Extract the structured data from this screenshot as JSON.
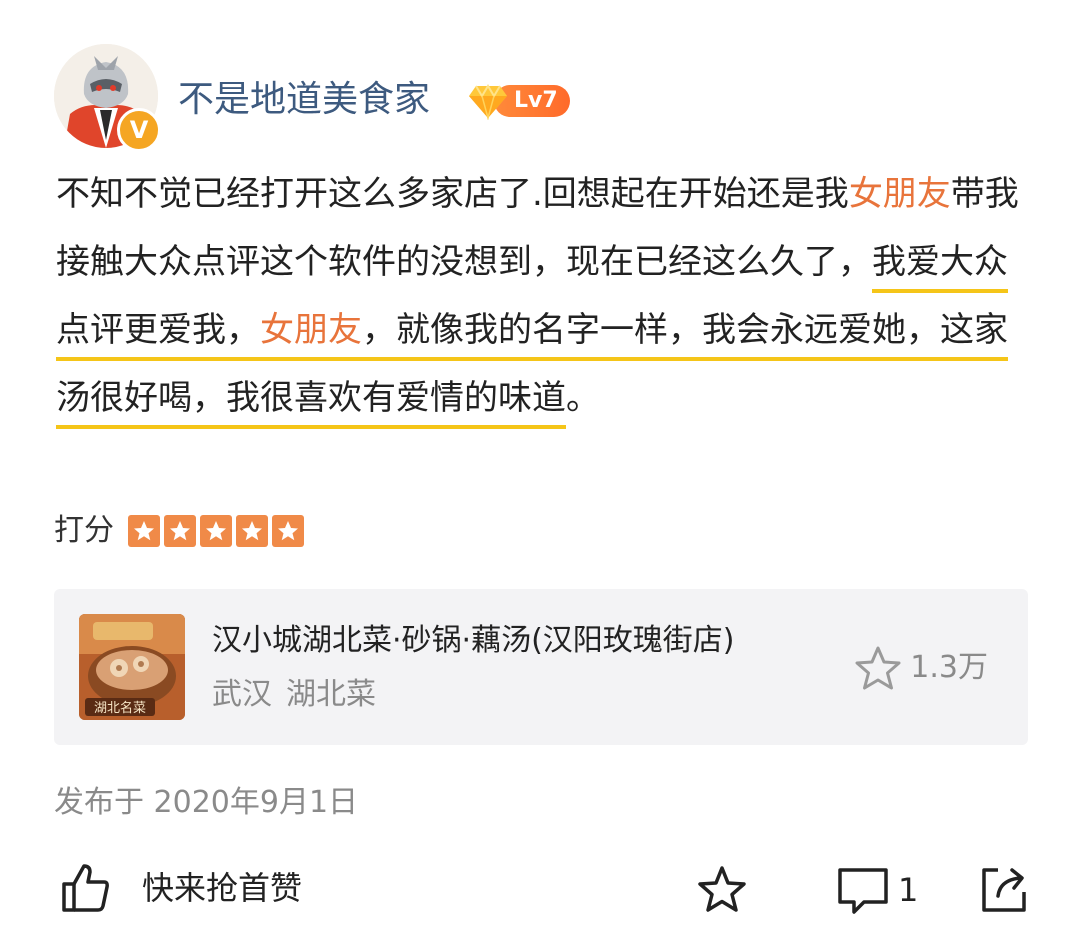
{
  "user": {
    "name": "不是地道美食家",
    "verified_badge": "V",
    "level": "Lv7",
    "avatar_icon": "masked-character-red-jacket-avatar"
  },
  "review": {
    "segments": [
      {
        "text": "不知不觉已经打开这么多家店了.回想起在开始还是我",
        "style": "normal"
      },
      {
        "text": "女朋友",
        "style": "highlight"
      },
      {
        "text": "带我接触大众点评这个软件的没想到，现在已经这么久了，",
        "style": "normal"
      },
      {
        "text": "我爱大众点评更爱我，",
        "style": "underline"
      },
      {
        "text": "女朋友",
        "style": "highlight-underline"
      },
      {
        "text": "，就像我的名字一样，我会永远爱她，这家汤很好喝，我很喜欢有爱情的味道",
        "style": "underline"
      },
      {
        "text": "。",
        "style": "normal"
      }
    ]
  },
  "rating": {
    "label": "打分",
    "stars": 5,
    "max_stars": 5
  },
  "shop": {
    "name": "汉小城湖北菜·砂锅·藕汤(汉阳玫瑰街店)",
    "city": "武汉",
    "cuisine": "湖北菜",
    "favorites": "1.3万",
    "thumb_text": "湖北名菜"
  },
  "post": {
    "date": "发布于 2020年9月1日"
  },
  "actions": {
    "like_label": "快来抢首赞",
    "comment_count": "1"
  },
  "colors": {
    "username": "#3d5a7f",
    "highlight": "#e8743b",
    "underline": "#f5c518",
    "star": "#f08a48",
    "card_bg": "#f3f3f5",
    "muted": "#8a8a8a"
  }
}
